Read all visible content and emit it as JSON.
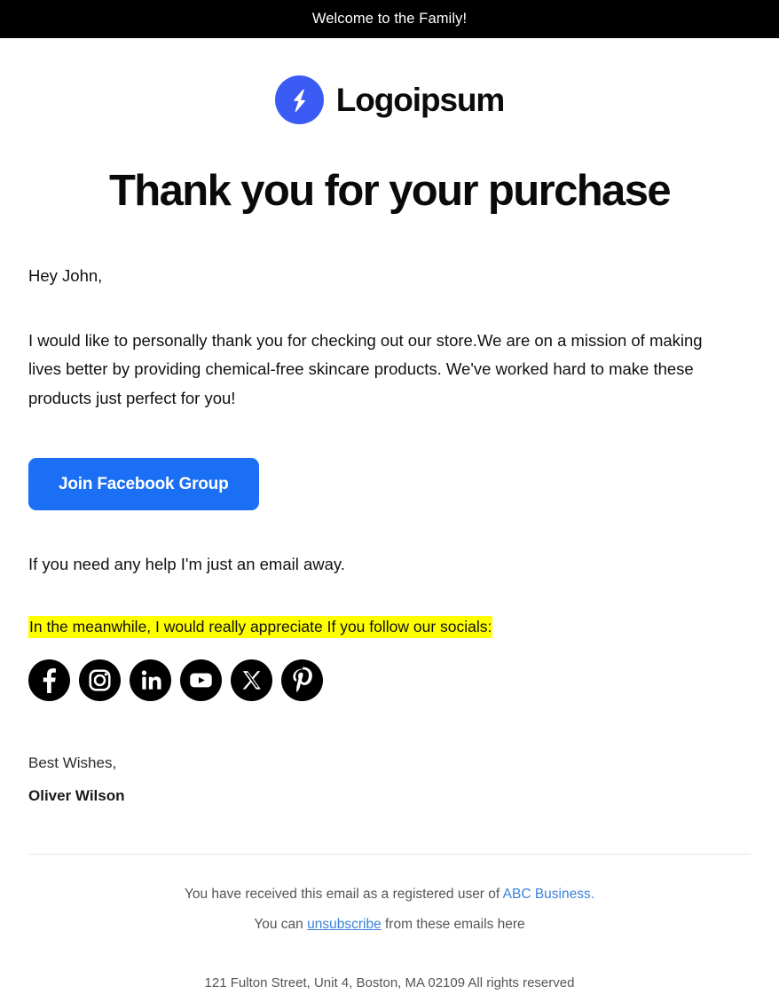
{
  "preheader": {
    "text": "Welcome to the Family!"
  },
  "brand": {
    "logo_icon": "lightning-bolt-icon",
    "logo_circle_color": "#3b5bf5",
    "name": "Logoipsum"
  },
  "main": {
    "title": "Thank you for your purchase",
    "greeting": "Hey John,",
    "paragraph": "I would like to personally thank you for checking out our store.We are on a mission of making lives better by providing chemical-free skincare products. We've worked hard to make these products just perfect for you!",
    "cta_label": "Join Facebook Group",
    "cta_color": "#1b6ff5",
    "help_line": "If you need any help I'm just an email away.",
    "highlight_text": "In the meanwhile, I would really appreciate If you follow our socials:",
    "highlight_color": "#ffff00"
  },
  "socials": [
    {
      "name": "Facebook",
      "icon": "facebook-icon"
    },
    {
      "name": "Instagram",
      "icon": "instagram-icon"
    },
    {
      "name": "LinkedIn",
      "icon": "linkedin-icon"
    },
    {
      "name": "YouTube",
      "icon": "youtube-icon"
    },
    {
      "name": "X",
      "icon": "x-twitter-icon"
    },
    {
      "name": "Pinterest",
      "icon": "pinterest-icon"
    }
  ],
  "signature": {
    "closing": "Best Wishes,",
    "name": "Oliver Wilson"
  },
  "footer": {
    "line1_prefix": "You have received this email as a registered user of ",
    "line1_link": "ABC Business.",
    "line2_prefix": "You can ",
    "line2_link": "unsubscribe",
    "line2_suffix": " from these emails here",
    "address": "121 Fulton Street, Unit 4, Boston, MA 02109 All rights reserved",
    "link_color": "#3b82d9"
  }
}
